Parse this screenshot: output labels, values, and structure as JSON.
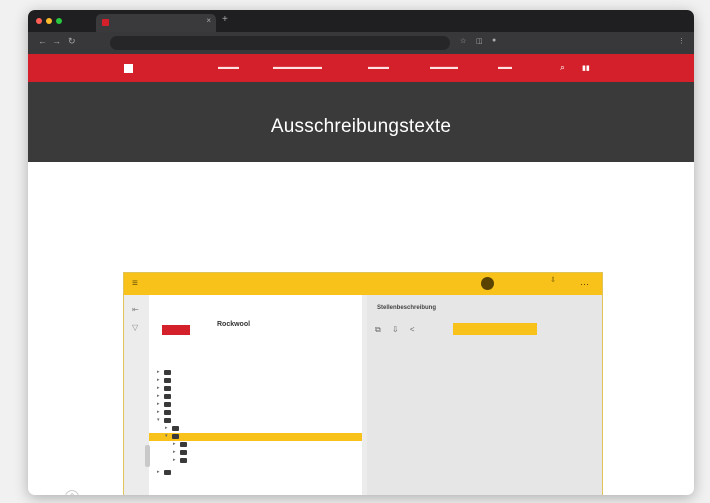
{
  "colors": {
    "brand_red": "#d4202a",
    "accent_yellow": "#f8c21a",
    "hero_bg": "#3a3a3a"
  },
  "hero": {
    "title": "Ausschreibungstexte"
  },
  "app": {
    "panel": {
      "heading": "Stellenbeschreibung"
    }
  },
  "tree": {
    "product_name": "Rockwool"
  }
}
